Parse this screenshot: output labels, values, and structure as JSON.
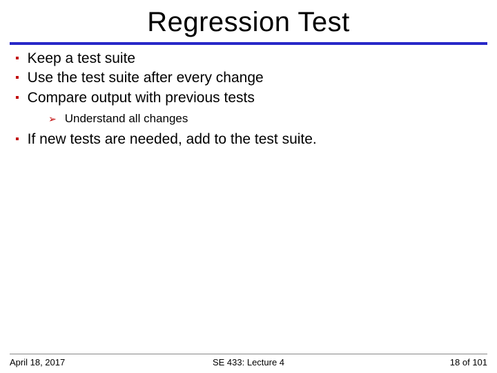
{
  "title": "Regression Test",
  "bullets": {
    "b0": "Keep a test suite",
    "b1": "Use the test suite after every change",
    "b2": "Compare output with previous tests",
    "b2sub0": "Understand all changes",
    "b3": "If new tests are needed, add to the test suite."
  },
  "footer": {
    "date": "April 18, 2017",
    "course": "SE 433: Lecture 4",
    "page": "18 of 101"
  }
}
